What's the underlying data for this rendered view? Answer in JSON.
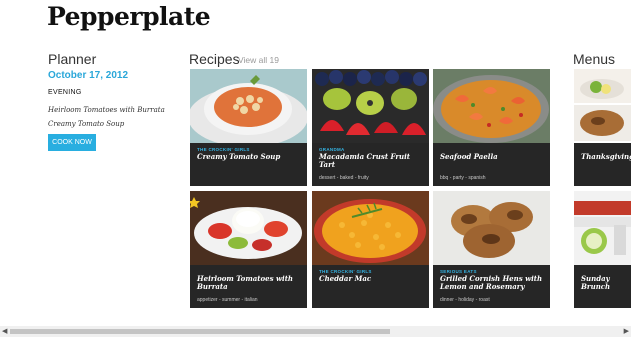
{
  "app": {
    "title": "Pepperplate"
  },
  "planner": {
    "title": "Planner",
    "date": "October 17, 2012",
    "slot": "EVENING",
    "recipes": [
      "Heirloom Tomatoes with Burrata",
      "Creamy Tomato Soup"
    ],
    "cook_button": "COOK NOW"
  },
  "recipes": {
    "title": "Recipes",
    "view_all": "View all 19",
    "tiles": [
      {
        "source": "THE CROCKIN' GIRLS",
        "name": "Creamy Tomato Soup",
        "tags": ""
      },
      {
        "source": "GRANDMA",
        "name": "Macadamia Crust Fruit Tart",
        "tags": "dessert - baked - fruity"
      },
      {
        "source": "",
        "name": "Seafood Paella",
        "tags": "bbq - party - spanish"
      },
      {
        "source": "",
        "name": "Heirloom Tomatoes with Burrata",
        "tags": "appetizer - summer - italian"
      },
      {
        "source": "THE CROCKIN' GIRLS",
        "name": "Cheddar Mac",
        "tags": ""
      },
      {
        "source": "SERIOUS EATS",
        "name": "Grilled Cornish Hens with Lemon and Rosemary",
        "tags": "dinner - holiday - roast"
      }
    ]
  },
  "menus": {
    "title": "Menus",
    "items": [
      {
        "name": "Thanksgiving"
      },
      {
        "name": "Sunday Brunch"
      }
    ]
  },
  "colors": {
    "accent": "#28aee0",
    "tile_bg": "#262626",
    "source_label": "#35b6e6"
  }
}
